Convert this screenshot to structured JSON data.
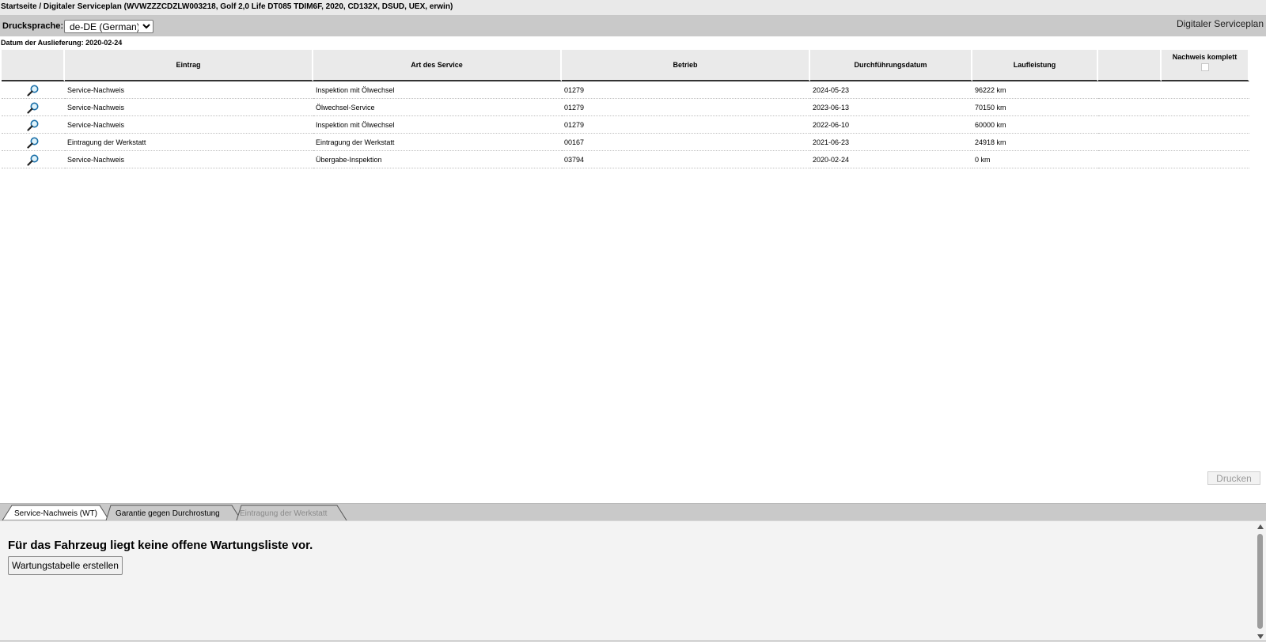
{
  "breadcrumb": "Startseite / Digitaler Serviceplan (WVWZZZCDZLW003218, Golf 2,0 Life DT085 TDIM6F, 2020, CD132X, DSUD, UEX, erwin)",
  "toolbar": {
    "print_language_label": "Druckspracheː",
    "print_language_value": "de-DE (German)",
    "app_title": "Digitaler Serviceplan"
  },
  "delivery_date": "Datum der Auslieferung: 2020-02-24",
  "table": {
    "headers": [
      "",
      "Eintrag",
      "Art des Service",
      "Betrieb",
      "Durchführungsdatum",
      "Laufleistung",
      "",
      "Nachweis komplett"
    ],
    "rows": [
      {
        "icon": "magnifier-icon",
        "eintrag": "Service-Nachweis",
        "art": "Inspektion mit Ölwechsel",
        "betrieb": "01279",
        "datum": "2024-05-23",
        "laufleistung": "96222 km"
      },
      {
        "icon": "magnifier-icon",
        "eintrag": "Service-Nachweis",
        "art": "Ölwechsel-Service",
        "betrieb": "01279",
        "datum": "2023-06-13",
        "laufleistung": "70150 km"
      },
      {
        "icon": "magnifier-icon",
        "eintrag": "Service-Nachweis",
        "art": "Inspektion mit Ölwechsel",
        "betrieb": "01279",
        "datum": "2022-06-10",
        "laufleistung": "60000 km"
      },
      {
        "icon": "magnifier-icon",
        "eintrag": "Eintragung der Werkstatt",
        "art": "Eintragung der Werkstatt",
        "betrieb": "00167",
        "datum": "2021-06-23",
        "laufleistung": "24918 km"
      },
      {
        "icon": "magnifier-icon",
        "eintrag": "Service-Nachweis",
        "art": "Übergabe-Inspektion",
        "betrieb": "03794",
        "datum": "2020-02-24",
        "laufleistung": "0 km"
      }
    ]
  },
  "print_button": "Drucken",
  "tabs": [
    {
      "label": "Service-Nachweis (WT)",
      "state": "active"
    },
    {
      "label": "Garantie gegen Durchrostung",
      "state": "normal"
    },
    {
      "label": "Eintragung der Werkstatt",
      "state": "disabled"
    }
  ],
  "bottom": {
    "message": "Für das Fahrzeug liegt keine offene Wartungsliste vor.",
    "create_button": "Wartungstabelle erstellen"
  },
  "colors": {
    "header_bar": "#c9c9c9",
    "breadcrumb_bg": "#e9e9e9",
    "lens_blue": "#1a6fa8",
    "disabled_text": "#9a9a9a"
  }
}
